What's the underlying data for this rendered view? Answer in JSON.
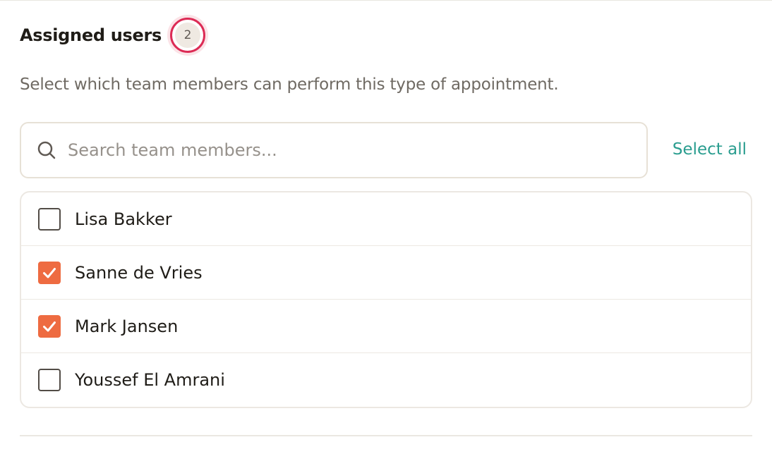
{
  "header": {
    "title": "Assigned users",
    "count": "2"
  },
  "description": "Select which team members can perform this type of appointment.",
  "search": {
    "placeholder": "Search team members...",
    "value": "",
    "icon": "search-icon"
  },
  "actions": {
    "select_all_label": "Select all"
  },
  "members": [
    {
      "name": "Lisa Bakker",
      "checked": false
    },
    {
      "name": "Sanne de Vries",
      "checked": true
    },
    {
      "name": "Mark Jansen",
      "checked": true
    },
    {
      "name": "Youssef El Amrani",
      "checked": false
    }
  ],
  "colors": {
    "accent": "#ee6b41",
    "link": "#2a9d8f",
    "focus_ring": "#dc2b55"
  }
}
